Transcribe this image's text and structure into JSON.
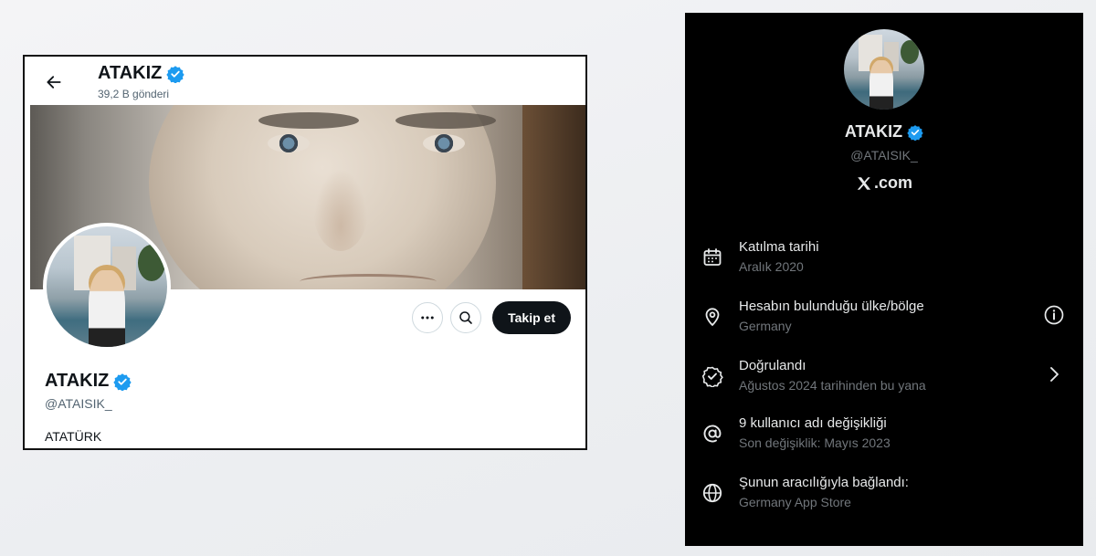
{
  "left": {
    "header": {
      "name": "ATAKIZ",
      "posts": "39,2 B gönderi"
    },
    "actions": {
      "follow_label": "Takip et"
    },
    "profile": {
      "name": "ATAKIZ",
      "handle": "@ATAISIK_",
      "bio": "ATATÜRK"
    },
    "colors": {
      "verified": "#1d9bf0",
      "follow_bg": "#0f1419"
    }
  },
  "right": {
    "name": "ATAKIZ",
    "handle": "@ATAISIK_",
    "site": ".com",
    "rows": [
      {
        "icon": "calendar-icon",
        "title": "Katılma tarihi",
        "sub": "Aralık 2020"
      },
      {
        "icon": "location-pin-icon",
        "title": "Hesabın bulunduğu ülke/bölge",
        "sub": "Germany"
      },
      {
        "icon": "verified-check-icon",
        "title": "Doğrulandı",
        "sub": "Ağustos 2024 tarihinden bu yana"
      },
      {
        "icon": "at-sign-icon",
        "title": "9 kullanıcı adı değişikliği",
        "sub": "Son değişiklik: Mayıs 2023"
      },
      {
        "icon": "globe-icon",
        "title": "Şunun aracılığıyla bağlandı:",
        "sub": "Germany App Store"
      }
    ],
    "colors": {
      "background": "#000000",
      "muted": "#71767b",
      "verified": "#1d9bf0"
    }
  }
}
